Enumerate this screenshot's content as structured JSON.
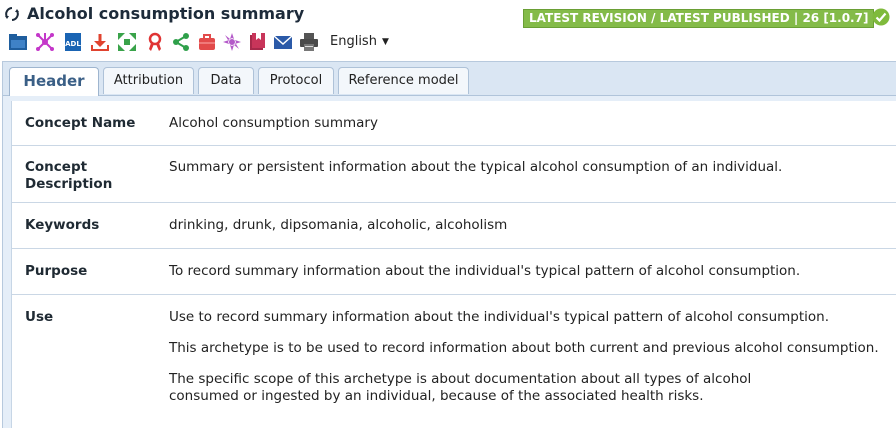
{
  "header": {
    "title": "Alcohol consumption summary",
    "revision_badge": "LATEST REVISION / LATEST PUBLISHED | 26 [1.0.7]"
  },
  "toolbar": {
    "language": "English",
    "icons": [
      "folder-icon",
      "mindmap-icon",
      "adl-icon",
      "download-icon",
      "expand-icon",
      "ribbon-icon",
      "share-icon",
      "briefcase-icon",
      "puzzle-icon",
      "bookmarks-icon",
      "mail-icon",
      "print-icon"
    ]
  },
  "tabs": [
    {
      "label": "Header"
    },
    {
      "label": "Attribution"
    },
    {
      "label": "Data"
    },
    {
      "label": "Protocol"
    },
    {
      "label": "Reference model"
    }
  ],
  "rows": [
    {
      "label": "Concept Name",
      "value": [
        "Alcohol consumption summary"
      ]
    },
    {
      "label": "Concept Description",
      "value": [
        "Summary or persistent information about the typical alcohol consumption of an individual."
      ]
    },
    {
      "label": "Keywords",
      "value": [
        "drinking, drunk, dipsomania, alcoholic, alcoholism"
      ]
    },
    {
      "label": "Purpose",
      "value": [
        "To record summary information about the individual's typical pattern of alcohol consumption."
      ]
    },
    {
      "label": "Use",
      "value": [
        "Use to record summary information about the individual's typical pattern of alcohol consumption.",
        "This archetype is to be used to record information about both current and previous alcohol consumption.",
        "The specific scope of this archetype is about documentation about all types of alcohol consumed or ingested by an individual, because of the associated health risks."
      ]
    }
  ],
  "colors": {
    "badge": "#84bb49",
    "tab_active_text": "#3a5f86",
    "tab_strip": "#dae6f3"
  }
}
